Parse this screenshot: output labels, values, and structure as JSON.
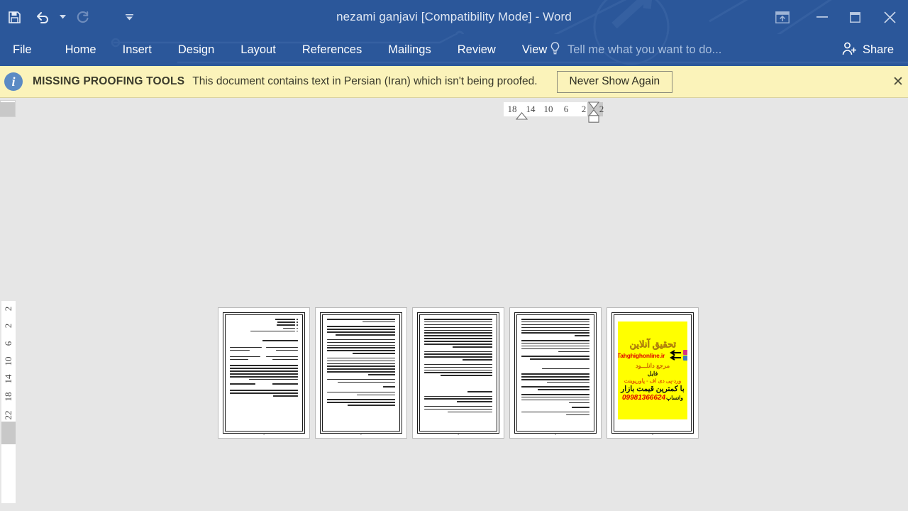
{
  "window": {
    "title": "nezami ganjavi [Compatibility Mode] - Word",
    "quick_access": [
      {
        "name": "save-icon",
        "label": "Save"
      },
      {
        "name": "undo-icon",
        "label": "Undo"
      },
      {
        "name": "redo-icon",
        "label": "Redo"
      },
      {
        "name": "customize-quick-access-toolbar-icon",
        "label": "Customize Quick Access Toolbar"
      }
    ],
    "controls": [
      {
        "name": "ribbon-display-options-icon",
        "label": "Ribbon Display Options"
      },
      {
        "name": "minimize-icon",
        "label": "Minimize",
        "glyph": "–"
      },
      {
        "name": "maximize-icon",
        "label": "Restore Down",
        "glyph": "☐"
      },
      {
        "name": "close-icon",
        "label": "Close",
        "glyph": "✕"
      }
    ]
  },
  "ribbon": {
    "tabs": [
      {
        "label": "File"
      },
      {
        "label": "Home"
      },
      {
        "label": "Insert"
      },
      {
        "label": "Design"
      },
      {
        "label": "Layout"
      },
      {
        "label": "References"
      },
      {
        "label": "Mailings"
      },
      {
        "label": "Review"
      },
      {
        "label": "View"
      }
    ],
    "tell_me": "Tell me what you want to do...",
    "share": "Share"
  },
  "notification": {
    "icon": "info-icon",
    "title": "MISSING PROOFING TOOLS",
    "message": "This document contains text in Persian (Iran) which isn't being proofed.",
    "button": "Never Show Again",
    "close": "✕",
    "bg_color": "#fbf3ba"
  },
  "rulers": {
    "horizontal": [
      "18",
      "14",
      "10",
      "6",
      "2",
      "2"
    ],
    "vertical": [
      "2",
      "2",
      "6",
      "10",
      "14",
      "18",
      "22"
    ],
    "corner_icon": "tab-selector-icon"
  },
  "document": {
    "zoom_view": "multiple-pages",
    "pages": [
      {
        "number": "1",
        "type": "text-bullets"
      },
      {
        "number": "2",
        "type": "text"
      },
      {
        "number": "3",
        "type": "text"
      },
      {
        "number": "4",
        "type": "text"
      },
      {
        "number": "5",
        "type": "advertisement"
      }
    ],
    "ad_page": {
      "title": "تحقیق آنلاین",
      "url": "Tahghighonline.ir",
      "reference": "مرجع دانلـــود",
      "file_label": "فایل",
      "formats": "ورد-پی دی اف - پاورپوینت",
      "price": "با کمترین قیمت بازار",
      "phone": "09981366624",
      "whatsapp": "واتساپ",
      "bg_color": "#ffff00"
    }
  },
  "colors": {
    "titlebar": "#2b579a",
    "workspace": "#e6e6e6",
    "notification": "#fbf3ba",
    "accent_red": "#e00000"
  }
}
